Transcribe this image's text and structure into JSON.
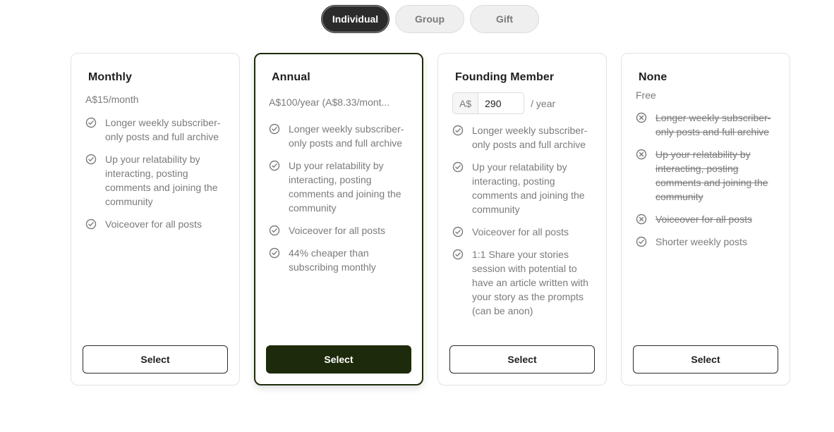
{
  "tabs": [
    {
      "label": "Individual",
      "active": true
    },
    {
      "label": "Group",
      "active": false
    },
    {
      "label": "Gift",
      "active": false
    }
  ],
  "colors": {
    "accent": "#1d2a0b",
    "active_tab": "#2b2b2b",
    "muted_text": "#7b7b7b",
    "border": "#e3e3e3"
  },
  "plans": [
    {
      "title": "Monthly",
      "price": "A$15/month",
      "features": [
        {
          "text": "Longer weekly subscriber-only posts and full archive",
          "icon": "check-circle-icon",
          "included": true
        },
        {
          "text": "Up your relatability by interacting, posting comments and joining the community",
          "icon": "check-circle-icon",
          "included": true
        },
        {
          "text": "Voiceover for all posts",
          "icon": "check-circle-icon",
          "included": true
        }
      ],
      "button_label": "Select"
    },
    {
      "title": "Annual",
      "price": "A$100/year (A$8.33/mont...",
      "features": [
        {
          "text": "Longer weekly subscriber-only posts and full archive",
          "icon": "check-circle-icon",
          "included": true
        },
        {
          "text": "Up your relatability by interacting, posting comments and joining the community",
          "icon": "check-circle-icon",
          "included": true
        },
        {
          "text": "Voiceover for all posts",
          "icon": "check-circle-icon",
          "included": true
        },
        {
          "text": "44% cheaper than subscribing monthly",
          "icon": "check-circle-icon",
          "included": true
        }
      ],
      "button_label": "Select"
    },
    {
      "title": "Founding Member",
      "currency": "A$",
      "amount": "290",
      "period": "/ year",
      "features": [
        {
          "text": "Longer weekly subscriber-only posts and full archive",
          "icon": "check-circle-icon",
          "included": true
        },
        {
          "text": "Up your relatability by interacting, posting comments and joining the community",
          "icon": "check-circle-icon",
          "included": true
        },
        {
          "text": "Voiceover for all posts",
          "icon": "check-circle-icon",
          "included": true
        },
        {
          "text": "1:1 Share your stories session with potential to have an article written with your story as the prompts (can be anon)",
          "icon": "check-circle-icon",
          "included": true
        }
      ],
      "button_label": "Select"
    },
    {
      "title": "None",
      "price": "Free",
      "features": [
        {
          "text": "Longer weekly subscriber-only posts and full archive",
          "icon": "x-circle-icon",
          "included": false
        },
        {
          "text": "Up your relatability by interacting, posting comments and joining the community",
          "icon": "x-circle-icon",
          "included": false
        },
        {
          "text": "Voiceover for all posts",
          "icon": "x-circle-icon",
          "included": false
        },
        {
          "text": "Shorter weekly posts",
          "icon": "check-circle-icon",
          "included": true
        }
      ],
      "button_label": "Select"
    }
  ]
}
